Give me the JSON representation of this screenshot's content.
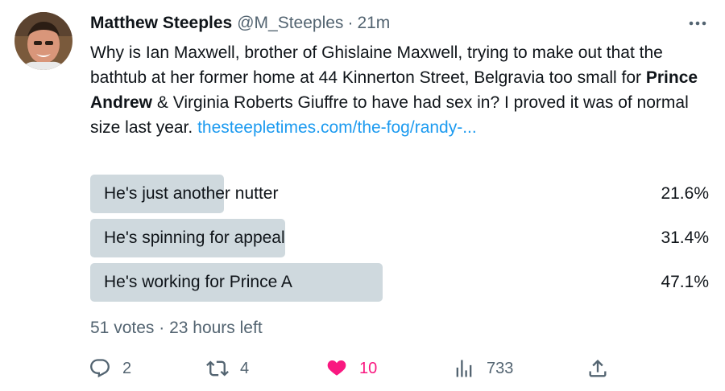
{
  "author": {
    "display_name": "Matthew Steeples",
    "handle": "@M_Steeples",
    "separator": "·",
    "time": "21m"
  },
  "tweet": {
    "text_part1": "Why is Ian Maxwell, brother of Ghislaine Maxwell, trying to make out that the bathtub at her former home at 44 Kinnerton Street, Belgravia too small for ",
    "text_bold": "Prince Andrew",
    "text_part2": " & Virginia Roberts Giuffre to have had sex in? I proved it was of normal size last year. ",
    "link_text": "thesteepletimes.com/the-fog/randy-..."
  },
  "poll": {
    "options": [
      {
        "label": "He's just another nutter",
        "percent_text": "21.6%",
        "percent": 21.6
      },
      {
        "label": "He's spinning for appeal",
        "percent_text": "31.4%",
        "percent": 31.4
      },
      {
        "label": "He's working for Prince A",
        "percent_text": "47.1%",
        "percent": 47.1
      }
    ],
    "votes": "51 votes",
    "meta_separator": "·",
    "time_left": "23 hours left"
  },
  "actions": {
    "replies": "2",
    "retweets": "4",
    "likes": "10",
    "views": "733"
  },
  "icons": {
    "more": "more-options-icon",
    "reply": "reply-icon",
    "retweet": "retweet-icon",
    "like": "heart-icon",
    "views": "views-icon",
    "share": "share-icon"
  },
  "colors": {
    "link": "#1d9bf0",
    "like": "#f91880",
    "secondary_text": "#536471",
    "poll_bar": "#cfd9de"
  }
}
